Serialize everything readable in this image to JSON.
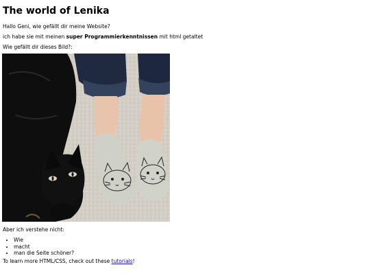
{
  "page": {
    "title": "The world of Lenika",
    "greeting": "Hallo Geni, wie gefällt dir meine Website?",
    "intro_before": "ich habe sie mit meinen ",
    "intro_bold": "super Programmierkenntnissen",
    "intro_after": " mit html getaltet",
    "question": "Wie gefällt dir dieses Bild?:",
    "image_desc": "black-cat-and-cat-face-shoes-photo",
    "not_understand": "Aber ich verstehe nicht:",
    "list_items": [
      "Wie",
      "macht",
      "man die Seite schöner?"
    ],
    "footer_before": "To learn more HTML/CSS, check out these ",
    "footer_link": "tutorials",
    "footer_after": "!"
  },
  "colors": {
    "link": "#1a0dab",
    "text": "#000000",
    "background": "#ffffff"
  }
}
